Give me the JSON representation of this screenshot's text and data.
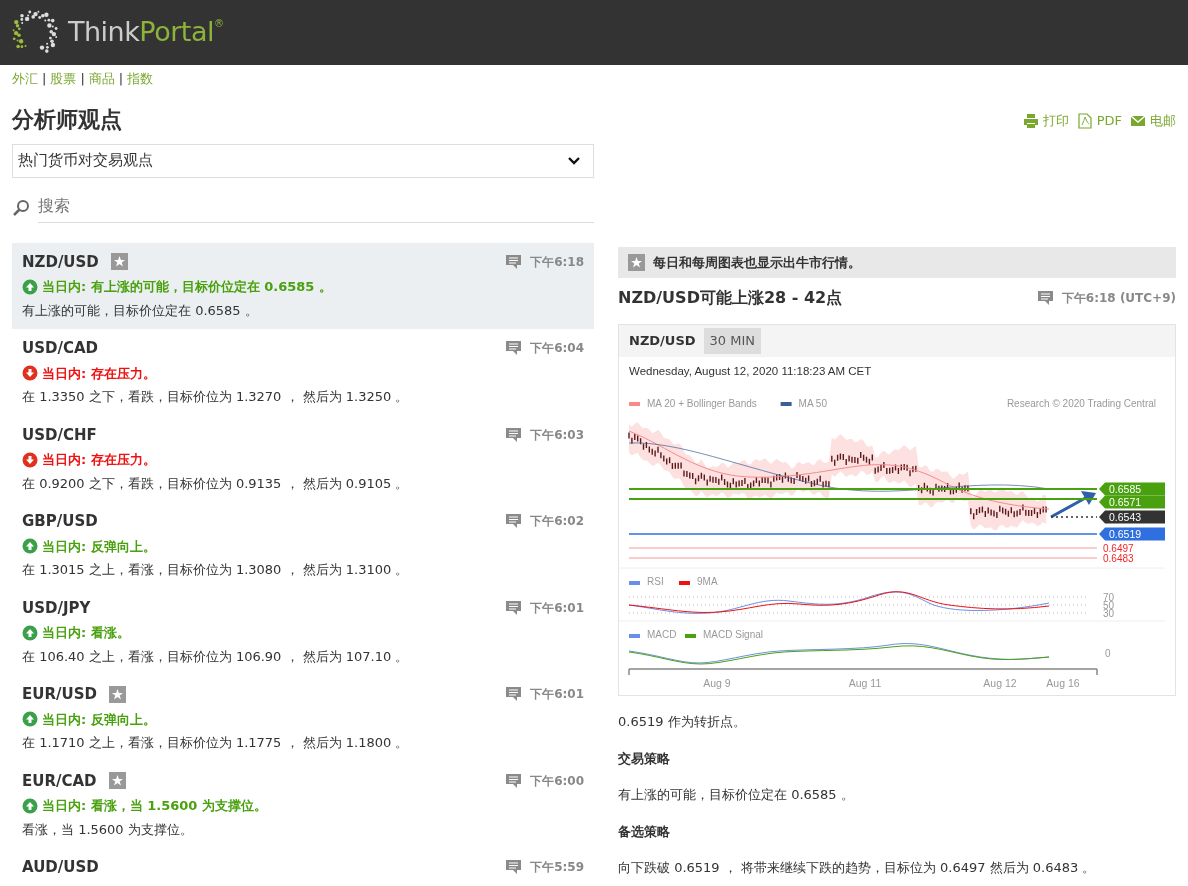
{
  "header": {
    "logo_first": "Think",
    "logo_second": "Portal",
    "logo_mark": "®"
  },
  "nav": [
    {
      "label": "外汇"
    },
    {
      "label": "股票"
    },
    {
      "label": "商品"
    },
    {
      "label": "指数"
    }
  ],
  "nav_separators": [
    "|",
    "|",
    "|"
  ],
  "page_title": "分析师观点",
  "actions": [
    {
      "kind": "print",
      "label": "打印"
    },
    {
      "kind": "pdf",
      "label": "PDF"
    },
    {
      "kind": "email",
      "label": "电邮"
    }
  ],
  "dropdown": {
    "value": "热门货币对交易观点"
  },
  "search": {
    "placeholder": "搜索"
  },
  "ideas": [
    {
      "pair": "NZD/USD",
      "starred": true,
      "selected": true,
      "time": "下午6:18",
      "kind": "up",
      "headline": "当日内: 有上涨的可能，目标价位定在 0.6585 。",
      "summary": "有上涨的可能，目标价位定在 0.6585 。"
    },
    {
      "pair": "USD/CAD",
      "starred": false,
      "selected": false,
      "time": "下午6:04",
      "kind": "down",
      "headline": "当日内: 存在压力。",
      "summary": "在 1.3350 之下，看跌，目标价位为 1.3270 ， 然后为 1.3250 。"
    },
    {
      "pair": "USD/CHF",
      "starred": false,
      "selected": false,
      "time": "下午6:03",
      "kind": "down",
      "headline": "当日内: 存在压力。",
      "summary": "在 0.9200 之下，看跌，目标价位为 0.9135 ， 然后为 0.9105 。"
    },
    {
      "pair": "GBP/USD",
      "starred": false,
      "selected": false,
      "time": "下午6:02",
      "kind": "up",
      "headline": "当日内: 反弹向上。",
      "summary": "在 1.3015 之上，看涨，目标价位为 1.3080 ， 然后为 1.3100 。"
    },
    {
      "pair": "USD/JPY",
      "starred": false,
      "selected": false,
      "time": "下午6:01",
      "kind": "up",
      "headline": "当日内: 看涨。",
      "summary": "在 106.40 之上，看涨，目标价位为 106.90 ， 然后为 107.10 。"
    },
    {
      "pair": "EUR/USD",
      "starred": true,
      "selected": false,
      "time": "下午6:01",
      "kind": "up",
      "headline": "当日内: 反弹向上。",
      "summary": "在 1.1710 之上，看涨，目标价位为 1.1775 ， 然后为 1.1800 。"
    },
    {
      "pair": "EUR/CAD",
      "starred": true,
      "selected": false,
      "time": "下午6:00",
      "kind": "up",
      "headline": "当日内: 看涨，当 1.5600 为支撑位。",
      "summary": "看涨，当 1.5600 为支撑位。"
    },
    {
      "pair": "AUD/USD",
      "starred": false,
      "selected": false,
      "time": "下午5:59"
    }
  ],
  "detail": {
    "banner": "每日和每周图表也显示出牛市行情。",
    "title": "NZD/USD可能上涨28 - 42点",
    "time": "下午6:18 (UTC+9)",
    "chart": {
      "pair": "NZD/USD",
      "timeframe": "30 MIN",
      "date": "Wednesday, August 12, 2020 11:18:23 AM CET",
      "legend": [
        {
          "label": "MA 20 + Bollinger Bands",
          "color": "#f98a8a"
        },
        {
          "label": "MA 50",
          "color": "#3c5f96"
        }
      ],
      "credit": "Research © 2020 Trading Central",
      "levels": [
        {
          "kind": "tag",
          "value": "0.6585",
          "color": "#4aa10f"
        },
        {
          "kind": "tag",
          "value": "0.6571",
          "color": "#4aa10f"
        },
        {
          "kind": "tag",
          "value": "0.6543",
          "color": "#333333"
        },
        {
          "kind": "tag",
          "value": "0.6519",
          "color": "#2f6fe0"
        },
        {
          "kind": "text",
          "value": "0.6497",
          "color": "#f02828"
        },
        {
          "kind": "text",
          "value": "0.6483",
          "color": "#f02828"
        }
      ],
      "rsi_legend": [
        {
          "label": "RSI",
          "color": "#6b8fe6"
        },
        {
          "label": "9MA",
          "color": "#ee1111"
        }
      ],
      "rsi_ticks": [
        "70",
        "50",
        "30"
      ],
      "macd_legend": [
        {
          "label": "MACD",
          "color": "#6b8fe6"
        },
        {
          "label": "MACD Signal",
          "color": "#4aa10f"
        }
      ],
      "macd_ticks": [
        "0"
      ],
      "x_labels": [
        "Aug 9",
        "Aug 11",
        "Aug 12",
        "Aug 16"
      ]
    },
    "pivot": "0.6519 作为转折点。",
    "sections": [
      {
        "heading": "交易策略",
        "text": "有上涨的可能，目标价位定在 0.6585 。"
      },
      {
        "heading": "备选策略",
        "text": "向下跌破 0.6519 ， 将带来继续下跌的趋势，目标位为 0.6497 然后为 0.6483 。"
      }
    ]
  }
}
